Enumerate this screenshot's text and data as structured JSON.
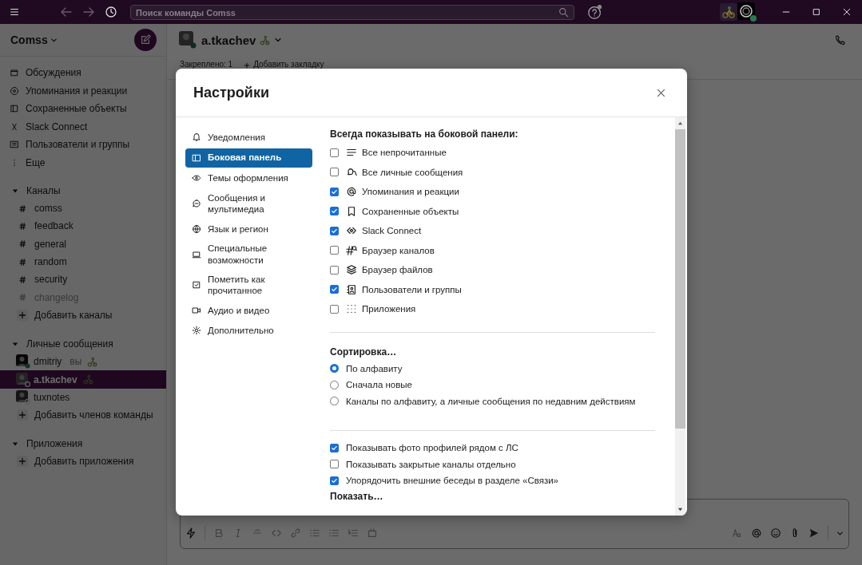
{
  "titlebar": {
    "search": {
      "placeholder": "Поиск команды Comss"
    }
  },
  "sidebar": {
    "workspace": "Comss",
    "nav": [
      {
        "label": "Обсуждения"
      },
      {
        "label": "Упоминания и реакции"
      },
      {
        "label": "Сохраненные объекты"
      },
      {
        "label": "Slack Connect"
      },
      {
        "label": "Пользователи и группы"
      },
      {
        "label": "Еще"
      }
    ],
    "channels": {
      "title": "Каналы",
      "items": [
        {
          "name": "comss",
          "muted": false
        },
        {
          "name": "feedback",
          "muted": false
        },
        {
          "name": "general",
          "muted": false
        },
        {
          "name": "random",
          "muted": false
        },
        {
          "name": "security",
          "muted": false
        },
        {
          "name": "changelog",
          "muted": true
        }
      ],
      "add": "Добавить каналы"
    },
    "direct_messages": {
      "title": "Личные сообщения",
      "items": [
        {
          "name": "dmitriy",
          "you": "вы",
          "selected": false,
          "online": true
        },
        {
          "name": "a.tkachev",
          "selected": true,
          "online": false
        },
        {
          "name": "tuxnotes",
          "selected": false,
          "online": false
        }
      ],
      "add": "Добавить членов команды"
    },
    "apps": {
      "title": "Приложения",
      "add": "Добавить приложения"
    }
  },
  "channel_header": {
    "name": "a.tkachev",
    "bookmarks": [
      "Закреплено: 1",
      "Добавить закладку"
    ]
  },
  "settings_dialog": {
    "title": "Настройки",
    "nav": [
      {
        "label": "Уведомления",
        "selected": false
      },
      {
        "label": "Боковая панель",
        "selected": true
      },
      {
        "label": "Темы оформления",
        "selected": false
      },
      {
        "label": "Сообщения и мультимедиа",
        "selected": false
      },
      {
        "label": "Язык и регион",
        "selected": false
      },
      {
        "label": "Специальные возможности",
        "selected": false
      },
      {
        "label": "Пометить как прочитанное",
        "selected": false
      },
      {
        "label": "Аудио и видео",
        "selected": false
      },
      {
        "label": "Дополнительно",
        "selected": false
      }
    ],
    "show_title": "Всегда показывать на боковой панели:",
    "show_items": [
      {
        "label": "Все непрочитанные",
        "checked": false
      },
      {
        "label": "Все личные сообщения",
        "checked": false
      },
      {
        "label": "Упоминания и реакции",
        "checked": true
      },
      {
        "label": "Сохраненные объекты",
        "checked": true
      },
      {
        "label": "Slack Connect",
        "checked": true
      },
      {
        "label": "Браузер каналов",
        "checked": false
      },
      {
        "label": "Браузер файлов",
        "checked": false
      },
      {
        "label": "Пользователи и группы",
        "checked": true
      },
      {
        "label": "Приложения",
        "checked": false
      }
    ],
    "sort_title": "Сортировка…",
    "sort_options": [
      {
        "label": "По алфавиту",
        "selected": true
      },
      {
        "label": "Сначала новые",
        "selected": false
      },
      {
        "label": "Каналы по алфавиту, а личные сообщения по недавним действиям",
        "selected": false
      }
    ],
    "extra_options": [
      {
        "label": "Показывать фото профилей рядом с ЛС",
        "checked": true
      },
      {
        "label": "Показывать закрытые каналы отдельно",
        "checked": false
      },
      {
        "label": "Упорядочить внешние беседы в разделе «Связи»",
        "checked": true
      }
    ],
    "next_title": "Показать…"
  }
}
